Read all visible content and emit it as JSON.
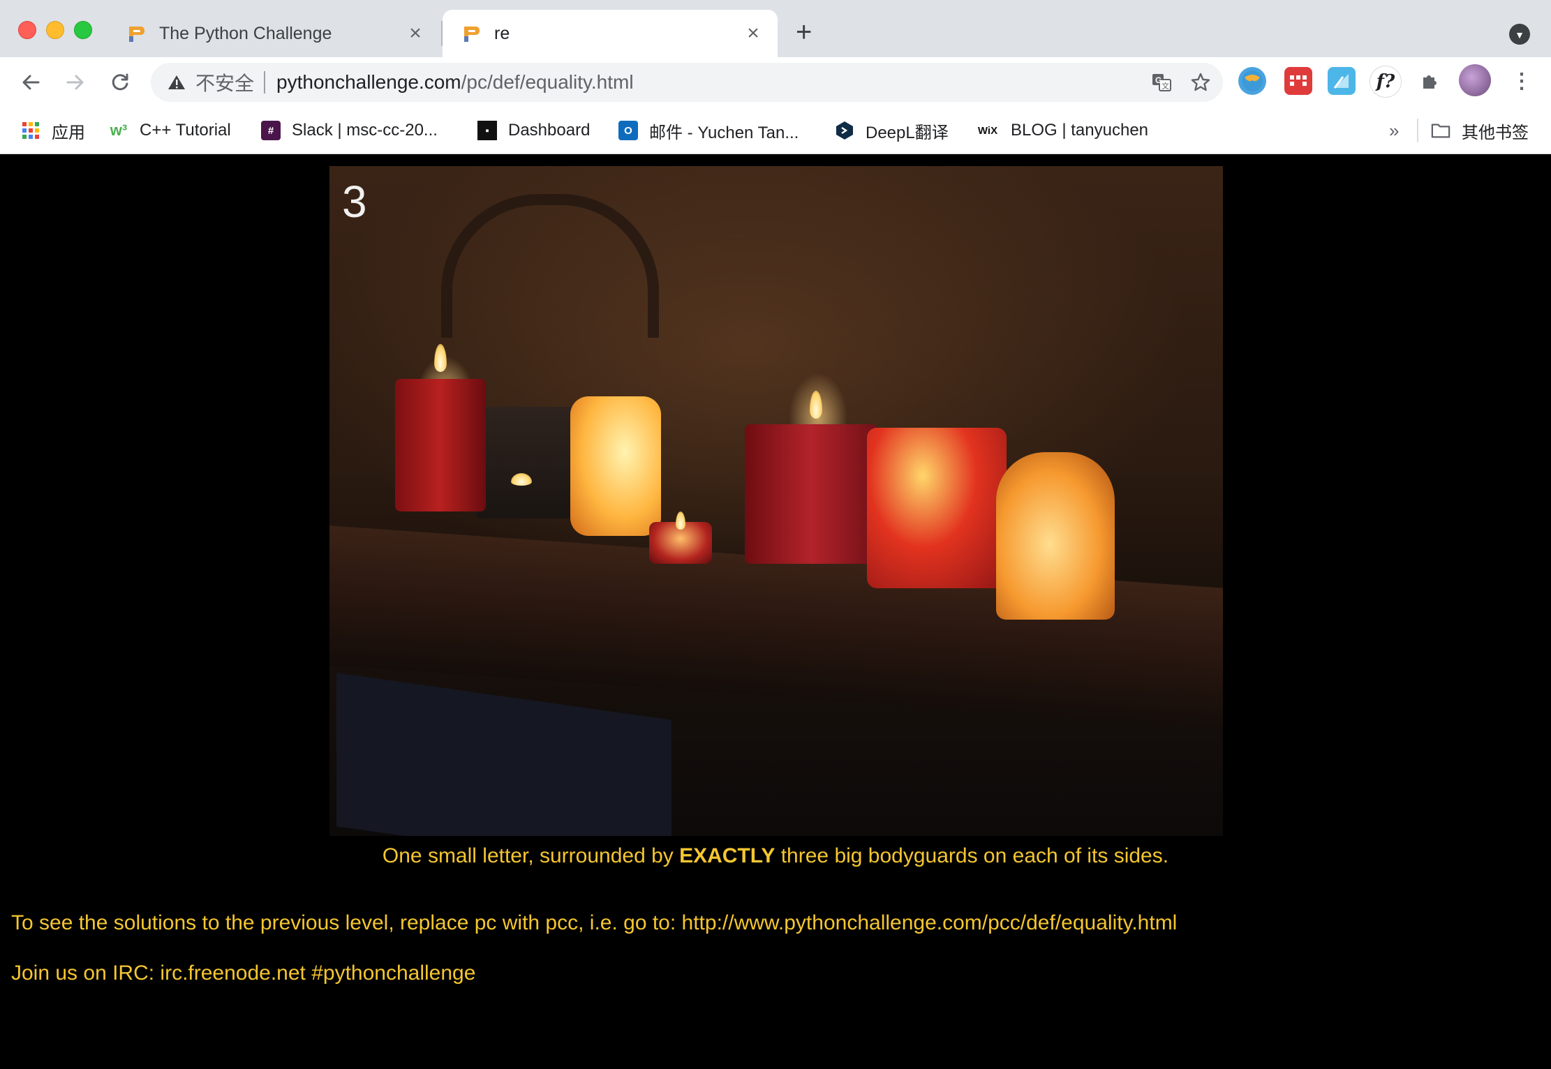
{
  "browser": {
    "tabs": [
      {
        "title": "The Python Challenge",
        "active": false
      },
      {
        "title": "re",
        "active": true
      }
    ],
    "address": {
      "security_label": "不安全",
      "host": "pythonchallenge.com",
      "path": "/pc/def/equality.html"
    },
    "bookmarks": [
      {
        "label": "应用",
        "icon": "apps-grid-icon"
      },
      {
        "label": "C++ Tutorial",
        "icon": "w3schools-icon"
      },
      {
        "label": "Slack | msc-cc-20...",
        "icon": "slack-icon"
      },
      {
        "label": "Dashboard",
        "icon": "dashboard-icon"
      },
      {
        "label": "邮件 - Yuchen Tan...",
        "icon": "outlook-icon"
      },
      {
        "label": "DeepL翻译",
        "icon": "deepl-icon"
      },
      {
        "label": "BLOG | tanyuchen",
        "icon": "wix-icon"
      }
    ],
    "bookmarks_overflow": "»",
    "other_bookmarks": "其他书签",
    "extensions": [
      "extension-1-icon",
      "extension-2-icon",
      "extension-3-icon",
      "formula-extension-icon",
      "puzzle-icon"
    ]
  },
  "page": {
    "photo_number": "3",
    "caption": {
      "before": "One small letter, surrounded by ",
      "emphasis": "EXACTLY",
      "after": " three big bodyguards on each of its sides."
    },
    "solutions_text": "To see the solutions to the previous level, replace pc with pcc, i.e. go to: http://www.pythonchallenge.com/pcc/def/equality.html",
    "irc_text": "Join us on IRC: irc.freenode.net #pythonchallenge"
  },
  "colors": {
    "page_background": "#000000",
    "text_accent": "#f5c631"
  }
}
